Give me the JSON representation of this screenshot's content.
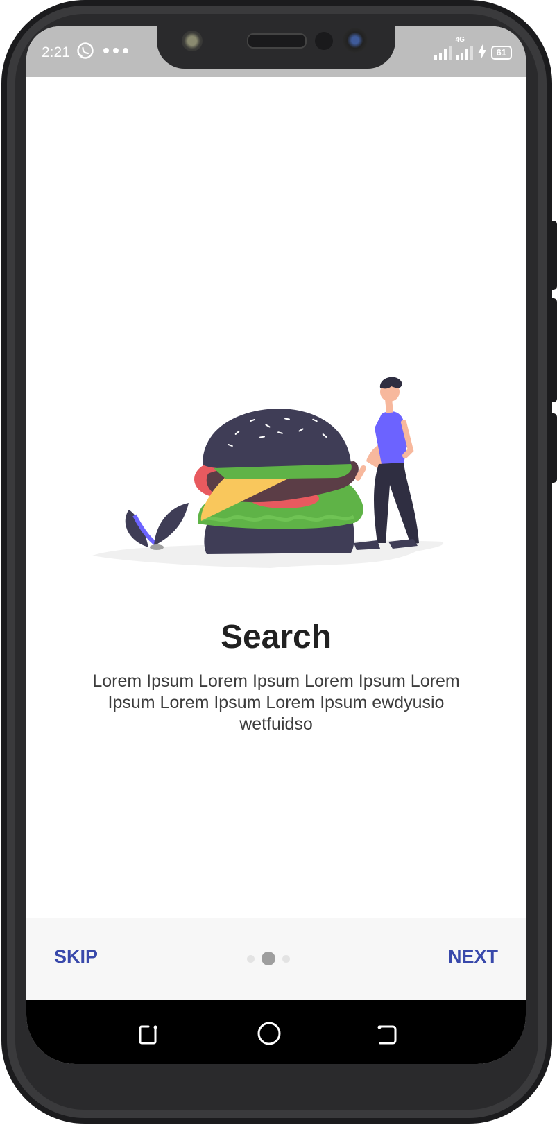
{
  "status_bar": {
    "time": "2:21",
    "network": "4G",
    "battery": "61",
    "icons": [
      "whatsapp-icon",
      "more-dots-icon",
      "signal-icon",
      "charging-icon",
      "battery-icon"
    ]
  },
  "onboarding": {
    "title": "Search",
    "description": "Lorem Ipsum Lorem Ipsum Lorem Ipsum Lorem Ipsum Lorem Ipsum Lorem Ipsum ewdyusio wetfuidso",
    "page_indicator": {
      "current": 2,
      "total": 3
    }
  },
  "bottom_bar": {
    "skip_label": "SKIP",
    "next_label": "NEXT"
  },
  "colors": {
    "accent": "#3949ab",
    "status_bar": "#bdbdbd",
    "burger_bun": "#3f3d56",
    "person_shirt": "#6c63ff",
    "lettuce": "#5fb347",
    "tomato": "#e85a5f",
    "cheese": "#f9c75c"
  },
  "nav": {
    "icons": [
      "recents-icon",
      "home-icon",
      "back-icon"
    ]
  }
}
